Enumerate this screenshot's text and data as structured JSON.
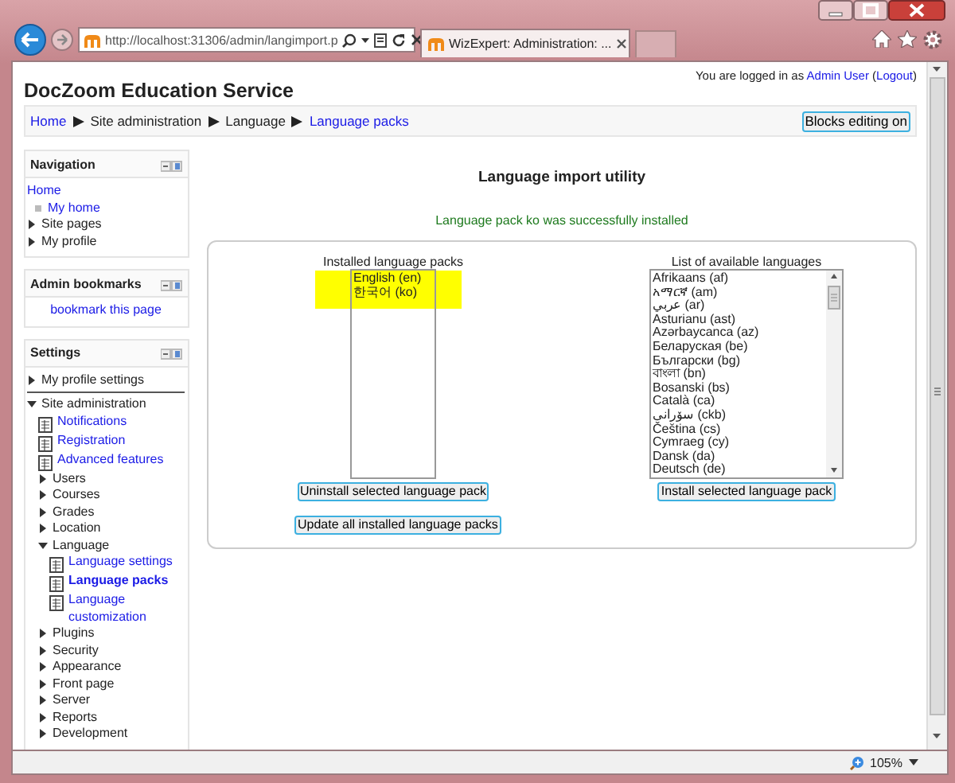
{
  "browser": {
    "address": "http://localhost:31306/admin/langimport.p",
    "tab_title": "WizExpert: Administration: ...",
    "zoom": "105%"
  },
  "header": {
    "site_name": "DocZoom Education Service",
    "login_prefix": "You are logged in as",
    "user": "Admin User",
    "paren_open": "(",
    "logout": "Logout",
    "paren_close": ")"
  },
  "breadcrumb": [
    {
      "label": "Home",
      "link": true
    },
    {
      "label": "Site administration",
      "link": false
    },
    {
      "label": "Language",
      "link": false
    },
    {
      "label": "Language packs",
      "link": true
    }
  ],
  "editing_button": "Blocks editing on",
  "blocks": [
    {
      "title": "Navigation",
      "items": [
        {
          "label": "Home",
          "kind": "link"
        },
        {
          "label": "My home",
          "kind": "bullet"
        },
        {
          "label": "Site pages",
          "kind": "branch",
          "expanded": false
        },
        {
          "label": "My profile",
          "kind": "branch",
          "expanded": false
        }
      ]
    },
    {
      "title": "Admin bookmarks",
      "items": [
        {
          "label": "bookmark this page",
          "kind": "center_link"
        }
      ]
    },
    {
      "title": "Settings",
      "items": [
        {
          "label": "My profile settings",
          "kind": "branch",
          "expanded": false
        },
        {
          "label": "Site administration",
          "kind": "branch",
          "expanded": true,
          "children": [
            {
              "label": "Notifications",
              "kind": "page",
              "selected": false
            },
            {
              "label": "Registration",
              "kind": "page",
              "selected": false
            },
            {
              "label": "Advanced features",
              "kind": "page",
              "selected": false
            },
            {
              "label": "Users",
              "kind": "branch",
              "expanded": false
            },
            {
              "label": "Courses",
              "kind": "branch",
              "expanded": false
            },
            {
              "label": "Grades",
              "kind": "branch",
              "expanded": false
            },
            {
              "label": "Location",
              "kind": "branch",
              "expanded": false
            },
            {
              "label": "Language",
              "kind": "branch",
              "expanded": true,
              "children": [
                {
                  "label": "Language settings",
                  "kind": "page",
                  "selected": false
                },
                {
                  "label": "Language packs",
                  "kind": "page",
                  "selected": true
                },
                {
                  "label": "Language customization",
                  "kind": "page",
                  "selected": false
                }
              ]
            },
            {
              "label": "Plugins",
              "kind": "branch",
              "expanded": false
            },
            {
              "label": "Security",
              "kind": "branch",
              "expanded": false
            },
            {
              "label": "Appearance",
              "kind": "branch",
              "expanded": false
            },
            {
              "label": "Front page",
              "kind": "branch",
              "expanded": false
            },
            {
              "label": "Server",
              "kind": "branch",
              "expanded": false
            },
            {
              "label": "Reports",
              "kind": "branch",
              "expanded": false
            },
            {
              "label": "Development",
              "kind": "branch",
              "expanded": false
            }
          ]
        }
      ]
    }
  ],
  "main": {
    "heading": "Language import utility",
    "message": "Language pack ko was successfully installed",
    "installed": {
      "label": "Installed language packs",
      "highlighted": true,
      "options": [
        "English (en)",
        "한국어 (ko)"
      ],
      "button": "Uninstall selected language pack"
    },
    "update_button": "Update all installed language packs",
    "available": {
      "label": "List of available languages",
      "highlighted": false,
      "options": [
        "Afrikaans (af)",
        "አማርኛ (am)",
        "عربي (ar)",
        "Asturianu (ast)",
        "Azərbaycanca (az)",
        "Беларуская (be)",
        "Български (bg)",
        "বাংলা (bn)",
        "Bosanski (bs)",
        "Català (ca)",
        "سۆرانی (ckb)",
        "Čeština (cs)",
        "Cymraeg (cy)",
        "Dansk (da)",
        "Deutsch (de)"
      ],
      "button": "Install selected language pack"
    }
  }
}
